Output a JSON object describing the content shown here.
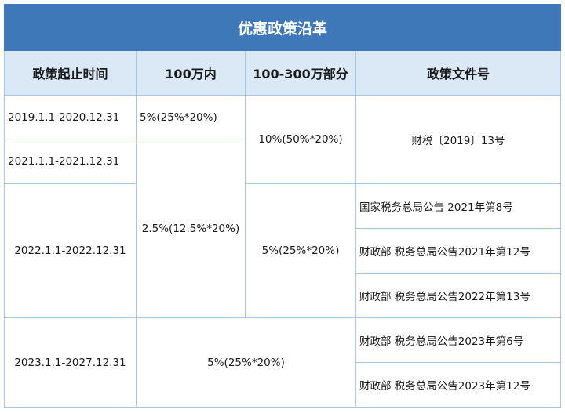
{
  "title": "优惠政策沿革",
  "headers": {
    "period": "政策起止时间",
    "under_1m": "100万内",
    "range_1m_3m": "100-300万部分",
    "doc_no": "政策文件号"
  },
  "rows": {
    "period_2019": "2019.1.1-2020.12.31",
    "period_2021": "2021.1.1-2021.12.31",
    "period_2022": "2022.1.1-2022.12.31",
    "period_2023": "2023.1.1-2027.12.31",
    "rate_2019_under_1m": "5%(25%*20%)",
    "rate_2021_2022_under_1m": "2.5%(12.5%*20%)",
    "rate_2019_2021_range": "10%(50%*20%)",
    "rate_2022_range": "5%(25%*20%)",
    "rate_2023_all": "5%(25%*20%)",
    "doc_2019": "财税〔2019〕13号",
    "doc_2021_8": "国家税务总局公告 2021年第8号",
    "doc_2021_12": "财政部 税务总局公告2021年第12号",
    "doc_2022_13": "财政部 税务总局公告2022年第13号",
    "doc_2023_6": "财政部 税务总局公告2023年第6号",
    "doc_2023_12": "财政部 税务总局公告2023年第12号"
  }
}
